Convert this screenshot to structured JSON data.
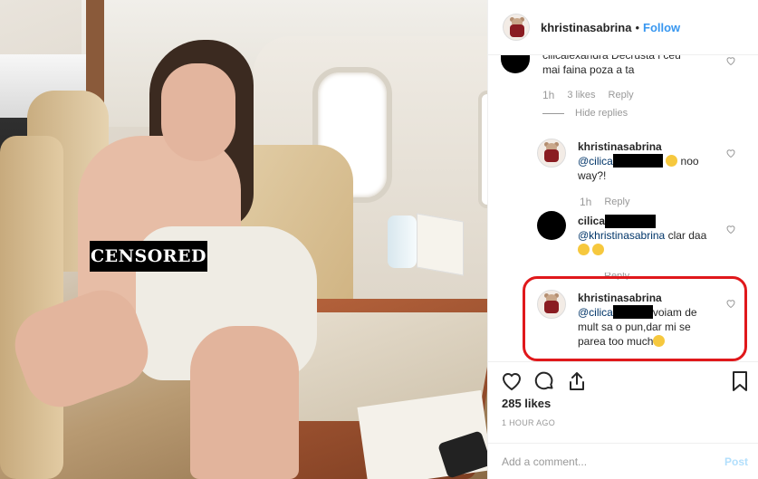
{
  "photo": {
    "censor_label": "CENSORED"
  },
  "header": {
    "username": "khristinasabrina",
    "separator": "•",
    "follow_label": "Follow"
  },
  "comments": [
    {
      "text_line1": "cilicalexandra Decrusta i ceu",
      "text_line2": "mai faina poza a ta",
      "time": "1h",
      "likes": "3 likes",
      "reply": "Reply",
      "hide_replies": "Hide replies"
    },
    {
      "username": "khristinasabrina",
      "mention": "@cilica",
      "text_after": "noo",
      "text_line2": "way?!",
      "time": "1h",
      "reply": "Reply"
    },
    {
      "username": "cilica",
      "mention": "@khristinasabrina",
      "text_after": "clar daa",
      "reply": "Reply"
    },
    {
      "username": "khristinasabrina",
      "mention": "@cilica",
      "text_after": "voiam de",
      "text_line2": "mult sa o pun,dar mi se",
      "text_line3": "parea too much"
    }
  ],
  "likes_label": "285 likes",
  "time_ago": "1 HOUR AGO",
  "comment_input": {
    "placeholder": "Add a comment...",
    "post_label": "Post"
  },
  "icons": [
    "heart-icon",
    "comment-icon",
    "share-icon",
    "bookmark-icon"
  ],
  "colors": {
    "follow": "#3897f0",
    "highlight": "#e0181b",
    "muted": "#999999"
  }
}
